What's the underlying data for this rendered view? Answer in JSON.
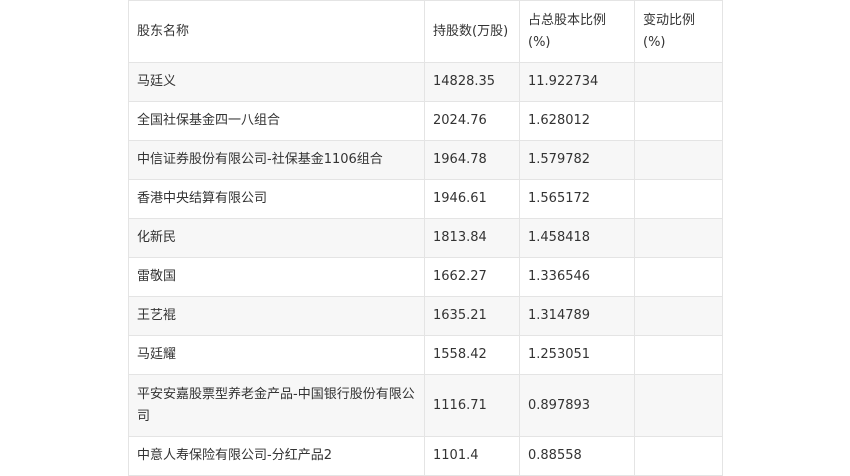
{
  "table": {
    "headers": [
      "股东名称",
      "持股数(万股)",
      "占总股本比例(%)",
      "变动比例(%)"
    ],
    "rows": [
      [
        "马廷义",
        "14828.35",
        "11.922734",
        ""
      ],
      [
        "全国社保基金四一八组合",
        "2024.76",
        "1.628012",
        ""
      ],
      [
        "中信证券股份有限公司-社保基金1106组合",
        "1964.78",
        "1.579782",
        ""
      ],
      [
        "香港中央结算有限公司",
        "1946.61",
        "1.565172",
        ""
      ],
      [
        "化新民",
        "1813.84",
        "1.458418",
        ""
      ],
      [
        "雷敬国",
        "1662.27",
        "1.336546",
        ""
      ],
      [
        "王艺裩",
        "1635.21",
        "1.314789",
        ""
      ],
      [
        "马廷耀",
        "1558.42",
        "1.253051",
        ""
      ],
      [
        "平安安嘉股票型养老金产品-中国银行股份有限公司",
        "1116.71",
        "0.897893",
        ""
      ],
      [
        "中意人寿保险有限公司-分红产品2",
        "1101.4",
        "0.88558",
        ""
      ]
    ]
  }
}
